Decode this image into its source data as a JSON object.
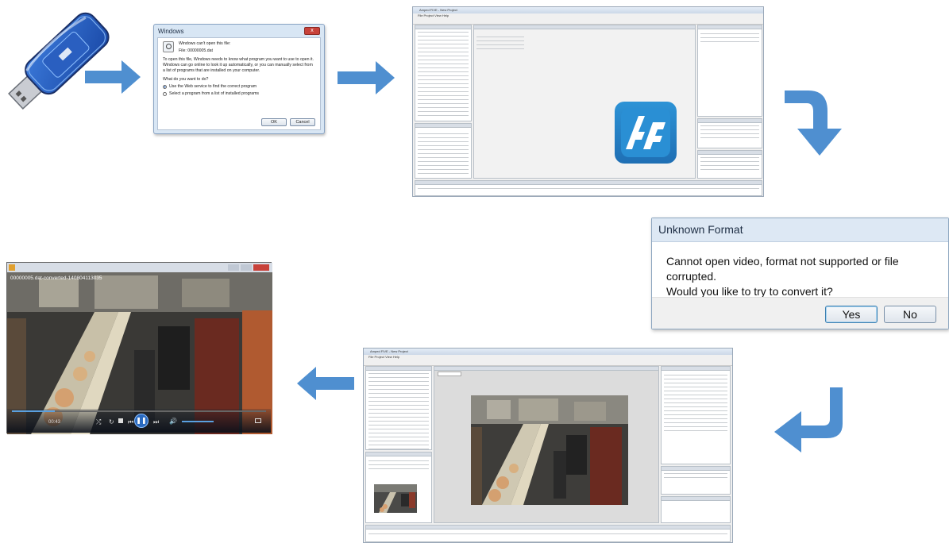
{
  "windows_dialog": {
    "title": "Windows",
    "heading": "Windows can't open this file:",
    "file_line": "File:   00000005.dat",
    "body": "To open this file, Windows needs to know what program you want to use to open it. Windows can go online to look it up automatically, or you can manually select from a list of programs that are installed on your computer.",
    "question": "What do you want to do?",
    "option_web": "Use the Web service to find the correct program",
    "option_list": "Select a program from a list of installed programs",
    "ok_label": "OK",
    "cancel_label": "Cancel",
    "close_glyph": "x"
  },
  "app_window": {
    "title": "Amped FIVE - New Project",
    "menu": "File   Project   View   Help",
    "logo_text": "AF",
    "logo_color": "#2d93d6"
  },
  "unknown_format_dialog": {
    "title": "Unknown Format",
    "message_line1": "Cannot open video, format not supported or file corrupted.",
    "message_line2": "Would you like to try to convert it?",
    "yes_label": "Yes",
    "no_label": "No"
  },
  "player": {
    "caption": "00000005.dat-converted-140804113035",
    "time_elapsed": "00:43",
    "time_remaining": "",
    "progress": 0.17
  },
  "colors": {
    "arrow": "#4f8fd0",
    "arrow_dark": "#3f7cbc"
  }
}
